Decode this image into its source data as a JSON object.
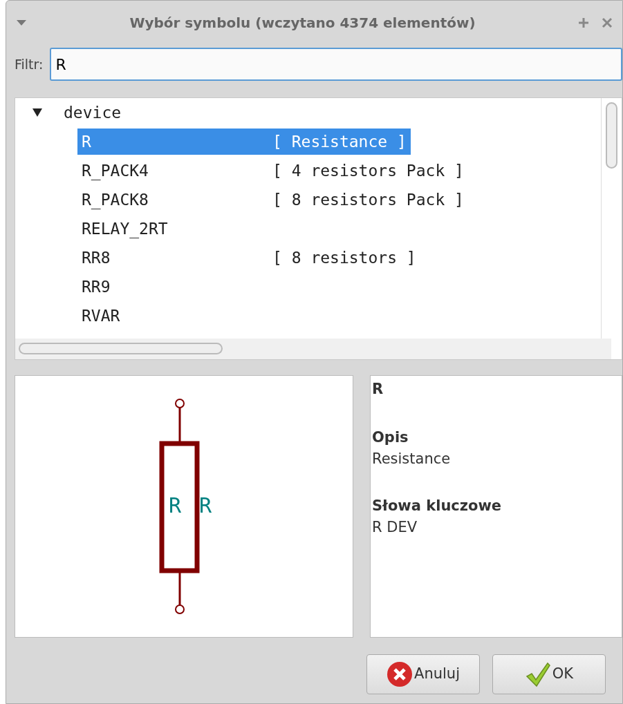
{
  "window": {
    "title": "Wybór symbolu (wczytano 4374 elementów)"
  },
  "filter": {
    "label": "Filtr:",
    "value": "R"
  },
  "tree": [
    {
      "name": "device",
      "expanded": true,
      "children": [
        {
          "name": "R",
          "description": "[ Resistance ]",
          "selected": true
        },
        {
          "name": "R_PACK4",
          "description": "[ 4 resistors Pack ]",
          "selected": false
        },
        {
          "name": "R_PACK8",
          "description": "[ 8 resistors Pack ]",
          "selected": false
        },
        {
          "name": "RELAY_2RT",
          "selected": false
        },
        {
          "name": "RR8",
          "description": "[ 8 resistors ]",
          "selected": false
        },
        {
          "name": "RR9",
          "selected": false
        },
        {
          "name": "RVAR",
          "selected": false
        }
      ]
    }
  ],
  "preview": {
    "reference": "R",
    "value": "R"
  },
  "info": {
    "name": "R",
    "sections": [
      {
        "heading": "Opis",
        "text": "Resistance"
      },
      {
        "heading": "Słowa kluczowe",
        "text": "R DEV"
      }
    ]
  },
  "buttons": [
    {
      "kind": "cancel",
      "label": "Anuluj"
    },
    {
      "kind": "ok",
      "label": "OK"
    }
  ]
}
